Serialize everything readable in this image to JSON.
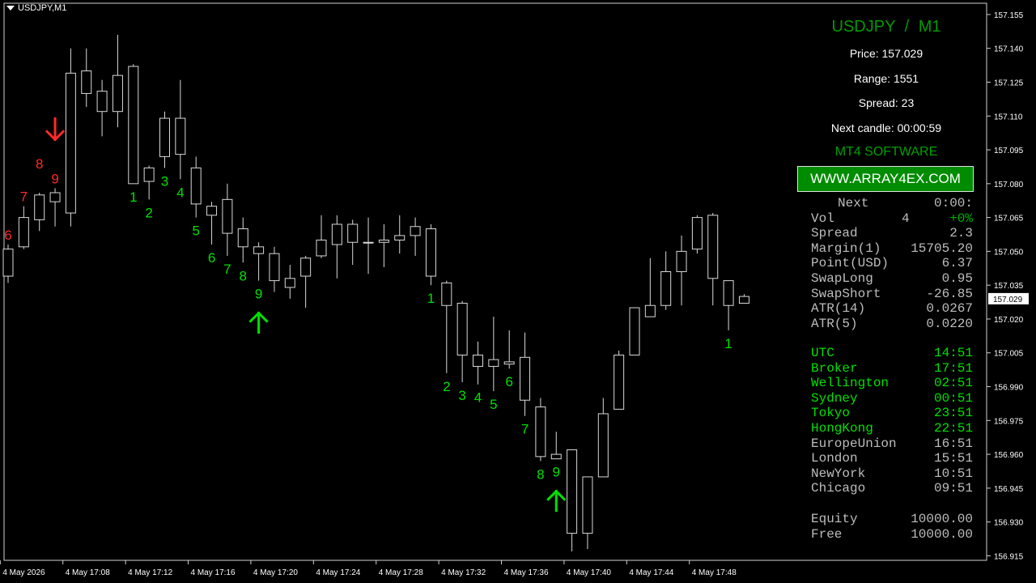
{
  "header": {
    "symbol": "USDJPY,M1"
  },
  "panel": {
    "title": "USDJPY / M1",
    "price_line": "Price: 157.029",
    "range_line": "Range: 1551",
    "spread_line": "Spread: 23",
    "next_candle_line": "Next candle: 00:00:59",
    "brand": "MT4 SOFTWARE",
    "url": "WWW.ARRAY4EX.COM"
  },
  "stats": {
    "next": {
      "label": "Next",
      "value": "0:00:"
    },
    "vol": {
      "label": "Vol",
      "value": "4",
      "change": "+0%"
    },
    "rows": [
      {
        "label": "Spread",
        "value": "2.3"
      },
      {
        "label": "Margin(1)",
        "value": "15705.20"
      },
      {
        "label": "Point(USD)",
        "value": "6.37"
      },
      {
        "label": "SwapLong",
        "value": "0.95"
      },
      {
        "label": "SwapShort",
        "value": "-26.85"
      },
      {
        "label": "ATR(14)",
        "value": "0.0267"
      },
      {
        "label": "ATR(5)",
        "value": "0.0220"
      }
    ]
  },
  "clocks": [
    {
      "label": "UTC",
      "value": "14:51",
      "color": "#00e000"
    },
    {
      "label": "Broker",
      "value": "17:51",
      "color": "#00e000"
    },
    {
      "label": "Wellington",
      "value": "02:51",
      "color": "#00e000"
    },
    {
      "label": "Sydney",
      "value": "00:51",
      "color": "#00e000"
    },
    {
      "label": "Tokyo",
      "value": "23:51",
      "color": "#00e000"
    },
    {
      "label": "HongKong",
      "value": "22:51",
      "color": "#00e000"
    },
    {
      "label": "EuropeUnion",
      "value": "16:51",
      "color": "#bdbdbd"
    },
    {
      "label": "London",
      "value": "15:51",
      "color": "#bdbdbd"
    },
    {
      "label": "NewYork",
      "value": "10:51",
      "color": "#bdbdbd"
    },
    {
      "label": "Chicago",
      "value": "09:51",
      "color": "#bdbdbd"
    }
  ],
  "account": [
    {
      "label": "Equity",
      "value": "10000.00"
    },
    {
      "label": "Free",
      "value": "10000.00"
    }
  ],
  "chart_data": {
    "type": "candlestick",
    "symbol": "USDJPY",
    "timeframe": "M1",
    "ylim": [
      156.913,
      157.16
    ],
    "y_ticks": [
      "157.155",
      "157.140",
      "157.125",
      "157.110",
      "157.095",
      "157.080",
      "157.065",
      "157.050",
      "157.035",
      "157.020",
      "157.005",
      "156.990",
      "156.975",
      "156.960",
      "156.945",
      "156.930",
      "156.915"
    ],
    "current_price": "157.029",
    "x_ticks": [
      {
        "bar": -0.5,
        "label": "4 May 2026"
      },
      {
        "bar": 3.5,
        "label": "4 May 17:08"
      },
      {
        "bar": 7.5,
        "label": "4 May 17:12"
      },
      {
        "bar": 11.5,
        "label": "4 May 17:16"
      },
      {
        "bar": 15.5,
        "label": "4 May 17:20"
      },
      {
        "bar": 19.5,
        "label": "4 May 17:24"
      },
      {
        "bar": 23.5,
        "label": "4 May 17:28"
      },
      {
        "bar": 27.5,
        "label": "4 May 17:32"
      },
      {
        "bar": 31.5,
        "label": "4 May 17:36"
      },
      {
        "bar": 35.5,
        "label": "4 May 17:40"
      },
      {
        "bar": 39.5,
        "label": "4 May 17:44"
      },
      {
        "bar": 43.5,
        "label": "4 May 17:48"
      }
    ],
    "candles": [
      {
        "o": 157.039,
        "h": 157.053,
        "l": 157.036,
        "c": 157.051
      },
      {
        "o": 157.052,
        "h": 157.07,
        "l": 157.051,
        "c": 157.065
      },
      {
        "o": 157.064,
        "h": 157.076,
        "l": 157.059,
        "c": 157.075
      },
      {
        "o": 157.072,
        "h": 157.078,
        "l": 157.061,
        "c": 157.076
      },
      {
        "o": 157.067,
        "h": 157.14,
        "l": 157.061,
        "c": 157.129
      },
      {
        "o": 157.12,
        "h": 157.14,
        "l": 157.114,
        "c": 157.13
      },
      {
        "o": 157.121,
        "h": 157.126,
        "l": 157.101,
        "c": 157.112
      },
      {
        "o": 157.112,
        "h": 157.146,
        "l": 157.105,
        "c": 157.128
      },
      {
        "o": 157.132,
        "h": 157.133,
        "l": 157.08,
        "c": 157.08
      },
      {
        "o": 157.081,
        "h": 157.088,
        "l": 157.073,
        "c": 157.087
      },
      {
        "o": 157.092,
        "h": 157.112,
        "l": 157.087,
        "c": 157.109
      },
      {
        "o": 157.093,
        "h": 157.126,
        "l": 157.082,
        "c": 157.109
      },
      {
        "o": 157.071,
        "h": 157.092,
        "l": 157.065,
        "c": 157.087
      },
      {
        "o": 157.07,
        "h": 157.072,
        "l": 157.053,
        "c": 157.066
      },
      {
        "o": 157.058,
        "h": 157.08,
        "l": 157.048,
        "c": 157.073
      },
      {
        "o": 157.06,
        "h": 157.065,
        "l": 157.045,
        "c": 157.052
      },
      {
        "o": 157.052,
        "h": 157.054,
        "l": 157.037,
        "c": 157.049
      },
      {
        "o": 157.037,
        "h": 157.052,
        "l": 157.032,
        "c": 157.049
      },
      {
        "o": 157.034,
        "h": 157.044,
        "l": 157.029,
        "c": 157.038
      },
      {
        "o": 157.039,
        "h": 157.048,
        "l": 157.025,
        "c": 157.047
      },
      {
        "o": 157.048,
        "h": 157.066,
        "l": 157.047,
        "c": 157.055
      },
      {
        "o": 157.053,
        "h": 157.066,
        "l": 157.038,
        "c": 157.062
      },
      {
        "o": 157.062,
        "h": 157.064,
        "l": 157.044,
        "c": 157.054
      },
      {
        "o": 157.054,
        "h": 157.065,
        "l": 157.04,
        "c": 157.054
      },
      {
        "o": 157.054,
        "h": 157.062,
        "l": 157.043,
        "c": 157.055
      },
      {
        "o": 157.055,
        "h": 157.066,
        "l": 157.049,
        "c": 157.057
      },
      {
        "o": 157.057,
        "h": 157.065,
        "l": 157.048,
        "c": 157.061
      },
      {
        "o": 157.06,
        "h": 157.062,
        "l": 157.035,
        "c": 157.039
      },
      {
        "o": 157.036,
        "h": 157.037,
        "l": 156.996,
        "c": 157.026
      },
      {
        "o": 157.027,
        "h": 157.028,
        "l": 156.992,
        "c": 157.004
      },
      {
        "o": 157.004,
        "h": 157.01,
        "l": 156.991,
        "c": 156.999
      },
      {
        "o": 157.002,
        "h": 157.021,
        "l": 156.988,
        "c": 156.999
      },
      {
        "o": 157.0,
        "h": 157.015,
        "l": 156.998,
        "c": 157.001
      },
      {
        "o": 157.003,
        "h": 157.014,
        "l": 156.977,
        "c": 156.984
      },
      {
        "o": 156.981,
        "h": 156.985,
        "l": 156.957,
        "c": 156.959
      },
      {
        "o": 156.96,
        "h": 156.97,
        "l": 156.958,
        "c": 156.958
      },
      {
        "o": 156.962,
        "h": 156.962,
        "l": 156.917,
        "c": 156.925
      },
      {
        "o": 156.95,
        "h": 156.95,
        "l": 156.918,
        "c": 156.925
      },
      {
        "o": 156.95,
        "h": 156.985,
        "l": 156.95,
        "c": 156.978
      },
      {
        "o": 156.98,
        "h": 157.006,
        "l": 156.98,
        "c": 157.004
      },
      {
        "o": 157.004,
        "h": 157.025,
        "l": 157.004,
        "c": 157.025
      },
      {
        "o": 157.021,
        "h": 157.047,
        "l": 157.021,
        "c": 157.026
      },
      {
        "o": 157.041,
        "h": 157.05,
        "l": 157.024,
        "c": 157.026
      },
      {
        "o": 157.05,
        "h": 157.057,
        "l": 157.026,
        "c": 157.041
      },
      {
        "o": 157.051,
        "h": 157.066,
        "l": 157.049,
        "c": 157.065
      },
      {
        "o": 157.066,
        "h": 157.067,
        "l": 157.026,
        "c": 157.038
      },
      {
        "o": 157.037,
        "h": 157.037,
        "l": 157.015,
        "c": 157.026
      },
      {
        "o": 157.03,
        "h": 157.031,
        "l": 157.027,
        "c": 157.027
      }
    ],
    "count_labels": [
      {
        "bar": 0,
        "text": "6",
        "color": "#ff2a2a",
        "pos": "above"
      },
      {
        "bar": 1,
        "text": "7",
        "color": "#ff2a2a",
        "pos": "above"
      },
      {
        "bar": 2,
        "text": "8",
        "color": "#ff2a2a",
        "pos": "above2"
      },
      {
        "bar": 3,
        "text": "9",
        "color": "#ff2a2a",
        "pos": "above"
      },
      {
        "bar": 8,
        "text": "1",
        "color": "#00e000",
        "pos": "below"
      },
      {
        "bar": 9,
        "text": "2",
        "color": "#00e000",
        "pos": "below"
      },
      {
        "bar": 10,
        "text": "3",
        "color": "#00e000",
        "pos": "below"
      },
      {
        "bar": 11,
        "text": "4",
        "color": "#00e000",
        "pos": "below"
      },
      {
        "bar": 12,
        "text": "5",
        "color": "#00e000",
        "pos": "below"
      },
      {
        "bar": 13,
        "text": "6",
        "color": "#00e000",
        "pos": "below"
      },
      {
        "bar": 14,
        "text": "7",
        "color": "#00e000",
        "pos": "below"
      },
      {
        "bar": 15,
        "text": "8",
        "color": "#00e000",
        "pos": "below"
      },
      {
        "bar": 16,
        "text": "9",
        "color": "#00e000",
        "pos": "below"
      },
      {
        "bar": 27,
        "text": "1",
        "color": "#00e000",
        "pos": "below"
      },
      {
        "bar": 28,
        "text": "2",
        "color": "#00e000",
        "pos": "below"
      },
      {
        "bar": 29,
        "text": "3",
        "color": "#00e000",
        "pos": "below"
      },
      {
        "bar": 30,
        "text": "4",
        "color": "#00e000",
        "pos": "below"
      },
      {
        "bar": 31,
        "text": "5",
        "color": "#00e000",
        "pos": "below"
      },
      {
        "bar": 32,
        "text": "6",
        "color": "#00e000",
        "pos": "below"
      },
      {
        "bar": 33,
        "text": "7",
        "color": "#00e000",
        "pos": "below"
      },
      {
        "bar": 34,
        "text": "8",
        "color": "#00e000",
        "pos": "below"
      },
      {
        "bar": 35,
        "text": "9",
        "color": "#00e000",
        "pos": "below"
      },
      {
        "bar": 46,
        "text": "1",
        "color": "#00e000",
        "pos": "below"
      }
    ],
    "arrows": [
      {
        "bar": 3,
        "dir": "down",
        "color": "#ff2a2a"
      },
      {
        "bar": 16,
        "dir": "up",
        "color": "#00e000"
      },
      {
        "bar": 35,
        "dir": "up",
        "color": "#00e000"
      }
    ]
  }
}
